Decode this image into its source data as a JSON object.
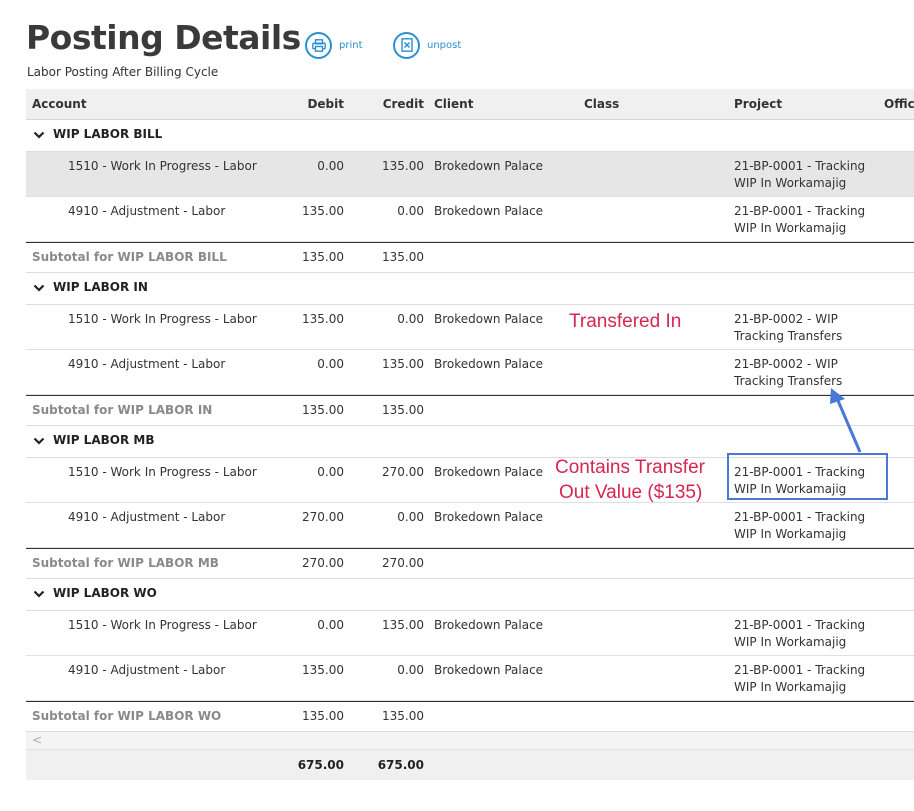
{
  "header": {
    "title": "Posting Details",
    "subtitle": "Labor Posting After Billing Cycle",
    "actions": [
      {
        "label": "print",
        "icon": "printer-icon"
      },
      {
        "label": "unpost",
        "icon": "unpost-icon"
      }
    ]
  },
  "table": {
    "columns": [
      "Account",
      "Debit",
      "Credit",
      "Client",
      "Class",
      "Project",
      "Offic"
    ],
    "groups": [
      {
        "name": "WIP LABOR BILL",
        "rows": [
          {
            "account": "1510 - Work In Progress - Labor",
            "debit": "0.00",
            "credit": "135.00",
            "client": "Brokedown Palace",
            "class": "",
            "project_line1": "21-BP-0001 - Tracking",
            "project_line2": "WIP In Workamajig"
          },
          {
            "account": "4910 - Adjustment - Labor",
            "debit": "135.00",
            "credit": "0.00",
            "client": "Brokedown Palace",
            "class": "",
            "project_line1": "21-BP-0001 - Tracking",
            "project_line2": "WIP In Workamajig"
          }
        ],
        "subtotal_label": "Subtotal for WIP LABOR BILL",
        "subtotal_debit": "135.00",
        "subtotal_credit": "135.00"
      },
      {
        "name": "WIP LABOR IN",
        "rows": [
          {
            "account": "1510 - Work In Progress - Labor",
            "debit": "135.00",
            "credit": "0.00",
            "client": "Brokedown Palace",
            "class": "",
            "project_line1": "21-BP-0002 - WIP",
            "project_line2": "Tracking Transfers"
          },
          {
            "account": "4910 - Adjustment - Labor",
            "debit": "0.00",
            "credit": "135.00",
            "client": "Brokedown Palace",
            "class": "",
            "project_line1": "21-BP-0002 - WIP",
            "project_line2": "Tracking Transfers"
          }
        ],
        "subtotal_label": "Subtotal for WIP LABOR IN",
        "subtotal_debit": "135.00",
        "subtotal_credit": "135.00"
      },
      {
        "name": "WIP LABOR MB",
        "rows": [
          {
            "account": "1510 - Work In Progress - Labor",
            "debit": "0.00",
            "credit": "270.00",
            "client": "Brokedown Palace",
            "class": "",
            "project_line1": "21-BP-0001 - Tracking",
            "project_line2": "WIP In Workamajig"
          },
          {
            "account": "4910 - Adjustment - Labor",
            "debit": "270.00",
            "credit": "0.00",
            "client": "Brokedown Palace",
            "class": "",
            "project_line1": "21-BP-0001 - Tracking",
            "project_line2": "WIP In Workamajig"
          }
        ],
        "subtotal_label": "Subtotal for WIP LABOR MB",
        "subtotal_debit": "270.00",
        "subtotal_credit": "270.00"
      },
      {
        "name": "WIP LABOR WO",
        "rows": [
          {
            "account": "1510 - Work In Progress - Labor",
            "debit": "0.00",
            "credit": "135.00",
            "client": "Brokedown Palace",
            "class": "",
            "project_line1": "21-BP-0001 - Tracking",
            "project_line2": "WIP In Workamajig"
          },
          {
            "account": "4910 - Adjustment - Labor",
            "debit": "135.00",
            "credit": "0.00",
            "client": "Brokedown Palace",
            "class": "",
            "project_line1": "21-BP-0001 - Tracking",
            "project_line2": "WIP In Workamajig"
          }
        ],
        "subtotal_label": "Subtotal for WIP LABOR WO",
        "subtotal_debit": "135.00",
        "subtotal_credit": "135.00"
      }
    ],
    "scroll_left_glyph": "<",
    "total_debit": "675.00",
    "total_credit": "675.00"
  },
  "annotations": {
    "transferred_in": "Transfered In",
    "transfer_out_line1": "Contains Transfer",
    "transfer_out_line2": "Out Value ($135)",
    "text_color": "#d6264f",
    "box_color": "#4a78d6"
  },
  "colors": {
    "accent": "#2a8fd1",
    "header_bg": "#f0f0f0",
    "selected_row_bg": "#e6e6e6"
  }
}
